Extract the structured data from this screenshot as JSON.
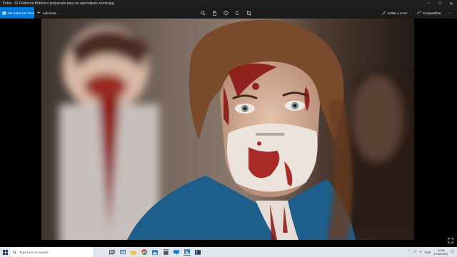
{
  "window": {
    "title": "Fotos - El Gobierno Británico preparado para un apocalipsis zombi.jpg",
    "controls": [
      "–",
      "□",
      "✕"
    ]
  },
  "commandbar": {
    "see_all_label": "Ver todas las fotos",
    "add_label": "Adicionar",
    "edit_label": "Editar y crear",
    "share_label": "Compartilhar",
    "more_label": "…"
  },
  "taskbar": {
    "search_placeholder": "Type here to search",
    "language": "POR",
    "time": "14:48",
    "date": "17/02/2021"
  },
  "colors": {
    "accent": "#0078d4",
    "titlebar": "#1f1f1f",
    "taskbar": "#dfe6ee"
  }
}
